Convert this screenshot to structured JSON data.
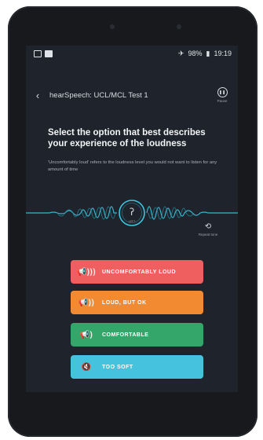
{
  "status": {
    "battery": "98%",
    "time": "19:19"
  },
  "header": {
    "title": "hearSpeech: UCL/MCL Test 1",
    "pause_label": "Pause"
  },
  "content": {
    "heading": "Select the option that best describes your experience of the loudness",
    "subtext": "'Uncomfortably loud' refers to the loudness level you would not want to listen for any amount of time",
    "ear_label": "LEFT",
    "replay_label": "Repeat tone"
  },
  "options": [
    {
      "label": "UNCOMFORTABLY LOUD",
      "color": "#ef5f5f",
      "icon": "megaphone-loud-icon"
    },
    {
      "label": "LOUD, BUT OK",
      "color": "#f28a31",
      "icon": "megaphone-medium-icon"
    },
    {
      "label": "COMFORTABLE",
      "color": "#34a66a",
      "icon": "megaphone-icon"
    },
    {
      "label": "TOO SOFT",
      "color": "#45c3de",
      "icon": "megaphone-muted-icon"
    }
  ],
  "colors": {
    "accent": "#3cc6e0",
    "background": "#1f242c"
  }
}
